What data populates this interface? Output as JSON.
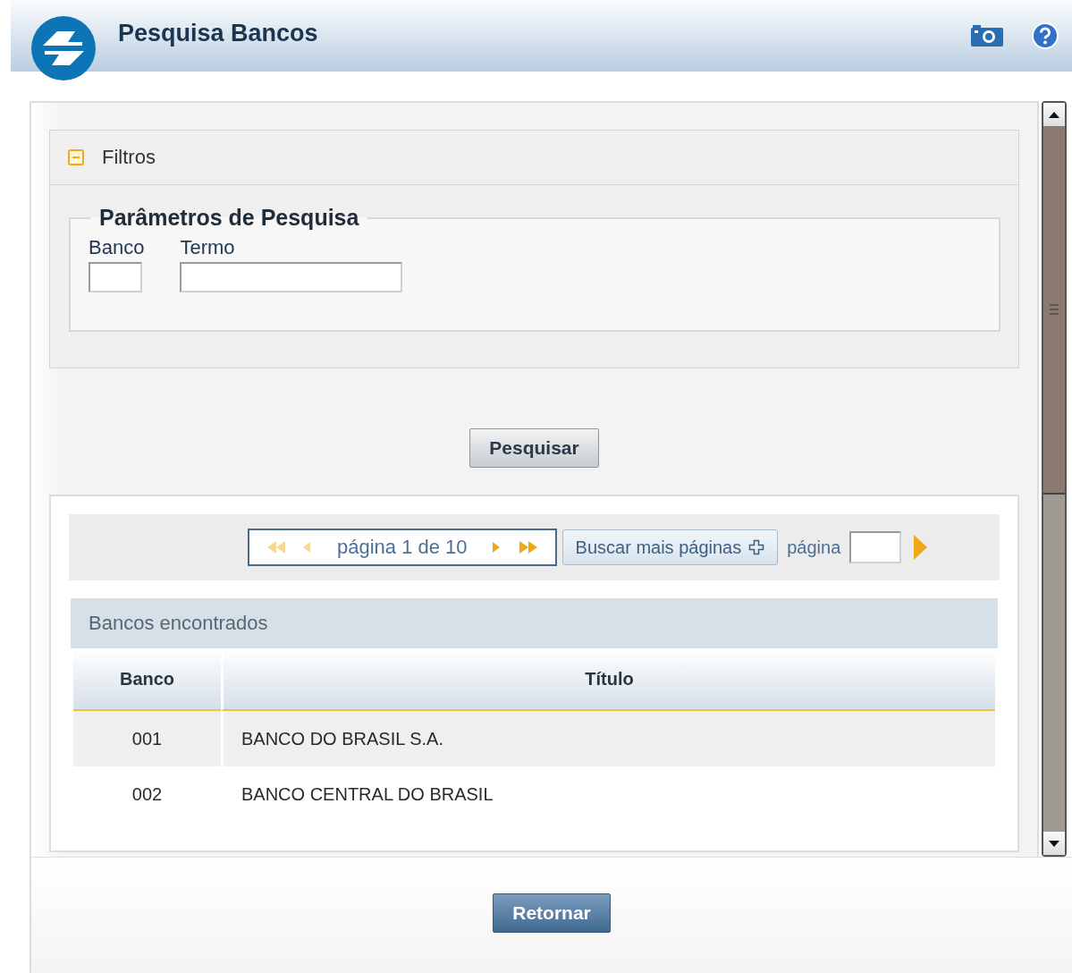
{
  "header": {
    "title": "Pesquisa Bancos"
  },
  "filters": {
    "title": "Filtros",
    "expanded": true,
    "legend": "Parâmetros de Pesquisa",
    "fields": [
      {
        "label": "Banco",
        "kind": "code"
      },
      {
        "label": "Termo",
        "kind": "text"
      }
    ]
  },
  "search_button": "Pesquisar",
  "pager": {
    "buttons": [
      {
        "kind": "first",
        "disabled": true
      },
      {
        "kind": "prev",
        "disabled": true
      },
      {
        "kind": "next",
        "disabled": false
      },
      {
        "kind": "last",
        "disabled": false
      }
    ],
    "page_info": "página 1 de 10",
    "more_button": "Buscar mais páginas",
    "goto_label": "página"
  },
  "results": {
    "title": "Bancos encontrados",
    "columns": [
      "Banco",
      "Título"
    ],
    "rows": [
      {
        "cells": [
          "001",
          "BANCO DO BRASIL S.A."
        ]
      },
      {
        "cells": [
          "002",
          "BANCO CENTRAL DO BRASIL"
        ]
      }
    ]
  },
  "footer_button": "Retornar"
}
